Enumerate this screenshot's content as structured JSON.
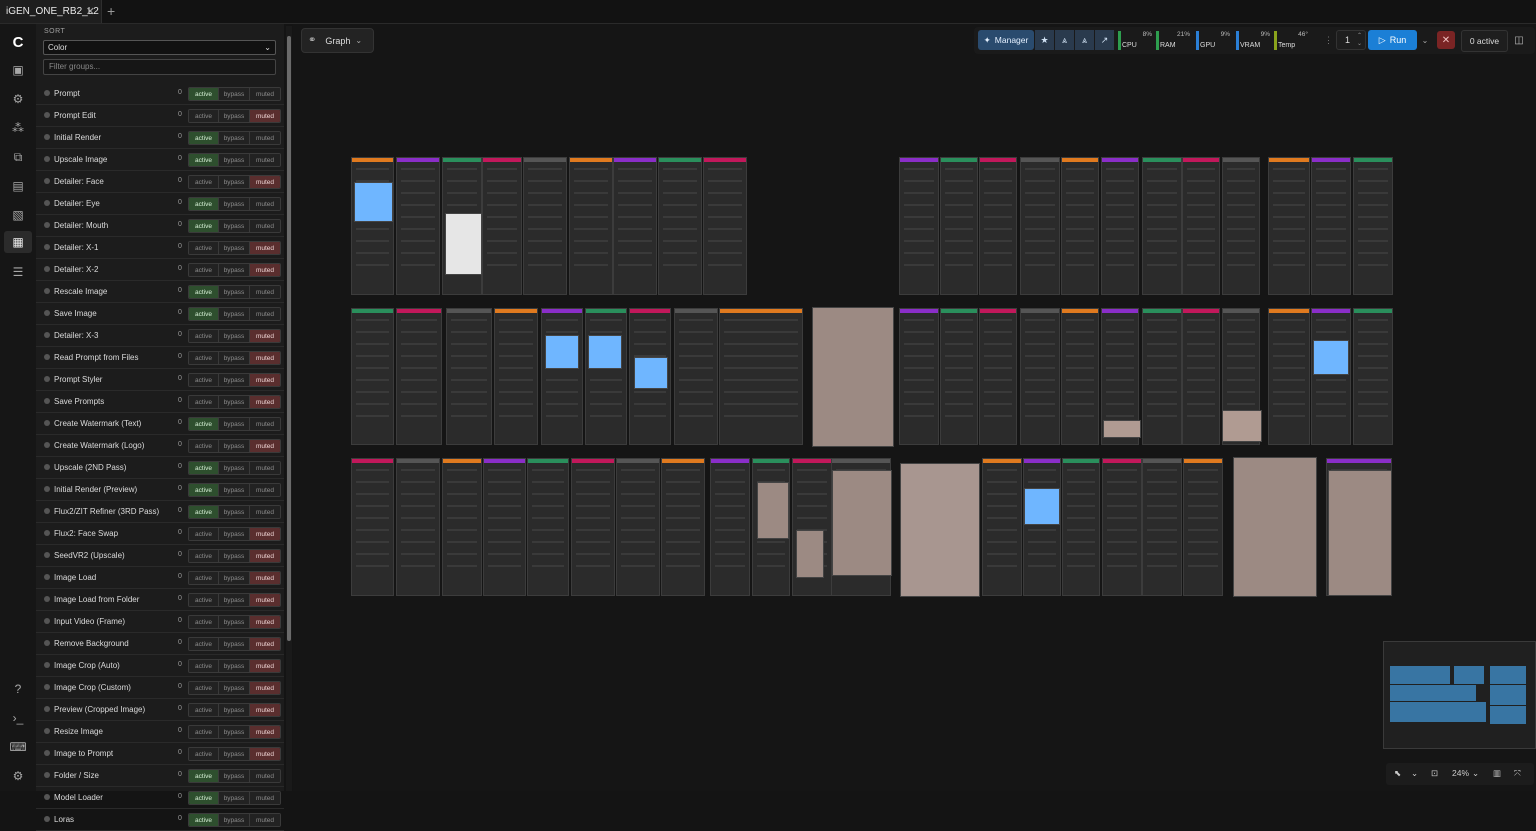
{
  "tab": {
    "title": "iGEN_ONE_RB2_L2",
    "close": "✕",
    "add": "+"
  },
  "sidebar": {
    "sort_label": "SORT",
    "sort_value": "Color",
    "filter_placeholder": "Filter groups...",
    "state_labels": {
      "active": "active",
      "bypass": "bypass",
      "muted": "muted"
    },
    "groups": [
      {
        "name": "Prompt",
        "count": "0",
        "state": "active"
      },
      {
        "name": "Prompt Edit",
        "count": "0",
        "state": "muted"
      },
      {
        "name": "Initial Render",
        "count": "0",
        "state": "active"
      },
      {
        "name": "Upscale Image",
        "count": "0",
        "state": "active"
      },
      {
        "name": "Detailer: Face",
        "count": "0",
        "state": "muted"
      },
      {
        "name": "Detailer: Eye",
        "count": "0",
        "state": "active"
      },
      {
        "name": "Detailer: Mouth",
        "count": "0",
        "state": "active"
      },
      {
        "name": "Detailer: X-1",
        "count": "0",
        "state": "muted"
      },
      {
        "name": "Detailer: X-2",
        "count": "0",
        "state": "muted"
      },
      {
        "name": "Rescale Image",
        "count": "0",
        "state": "active"
      },
      {
        "name": "Save Image",
        "count": "0",
        "state": "active"
      },
      {
        "name": "Detailer: X-3",
        "count": "0",
        "state": "muted"
      },
      {
        "name": "Read Prompt from Files",
        "count": "0",
        "state": "muted"
      },
      {
        "name": "Prompt Styler",
        "count": "0",
        "state": "muted"
      },
      {
        "name": "Save Prompts",
        "count": "0",
        "state": "muted"
      },
      {
        "name": "Create Watermark (Text)",
        "count": "0",
        "state": "active"
      },
      {
        "name": "Create Watermark (Logo)",
        "count": "0",
        "state": "muted"
      },
      {
        "name": "Upscale (2ND Pass)",
        "count": "0",
        "state": "active"
      },
      {
        "name": "Initial Render (Preview)",
        "count": "0",
        "state": "active"
      },
      {
        "name": "Flux2/ZIT Refiner (3RD Pass)",
        "count": "0",
        "state": "active"
      },
      {
        "name": "Flux2: Face Swap",
        "count": "0",
        "state": "muted"
      },
      {
        "name": "SeedVR2 (Upscale)",
        "count": "0",
        "state": "muted"
      },
      {
        "name": "Image Load",
        "count": "0",
        "state": "muted"
      },
      {
        "name": "Image Load from Folder",
        "count": "0",
        "state": "muted"
      },
      {
        "name": "Input Video (Frame)",
        "count": "0",
        "state": "muted"
      },
      {
        "name": "Remove Background",
        "count": "0",
        "state": "muted"
      },
      {
        "name": "Image Crop (Auto)",
        "count": "0",
        "state": "muted"
      },
      {
        "name": "Image Crop (Custom)",
        "count": "0",
        "state": "muted"
      },
      {
        "name": "Preview (Cropped Image)",
        "count": "0",
        "state": "muted"
      },
      {
        "name": "Resize Image",
        "count": "0",
        "state": "muted"
      },
      {
        "name": "Image to Prompt",
        "count": "0",
        "state": "muted"
      },
      {
        "name": "Folder / Size",
        "count": "0",
        "state": "active"
      },
      {
        "name": "Model Loader",
        "count": "0",
        "state": "active"
      },
      {
        "name": "Loras",
        "count": "0",
        "state": "active"
      }
    ]
  },
  "canvas": {
    "graph_label": "Graph",
    "manager_label": "Manager",
    "meters": [
      {
        "name": "CPU",
        "pct": "8%",
        "color": "#2e9e4f"
      },
      {
        "name": "RAM",
        "pct": "21%",
        "color": "#2e9e4f"
      },
      {
        "name": "GPU",
        "pct": "9%",
        "color": "#2b7fd6"
      },
      {
        "name": "VRAM",
        "pct": "9%",
        "color": "#2b7fd6"
      },
      {
        "name": "Temp",
        "pct": "46°",
        "color": "#8aa31c"
      }
    ],
    "batch_count": "1",
    "run_label": "Run",
    "queue_status": "0 active",
    "zoom": "24%"
  },
  "colors": {
    "active": "#2e4f2e",
    "muted": "#5a2e2e",
    "accent": "#1b7fd6"
  }
}
